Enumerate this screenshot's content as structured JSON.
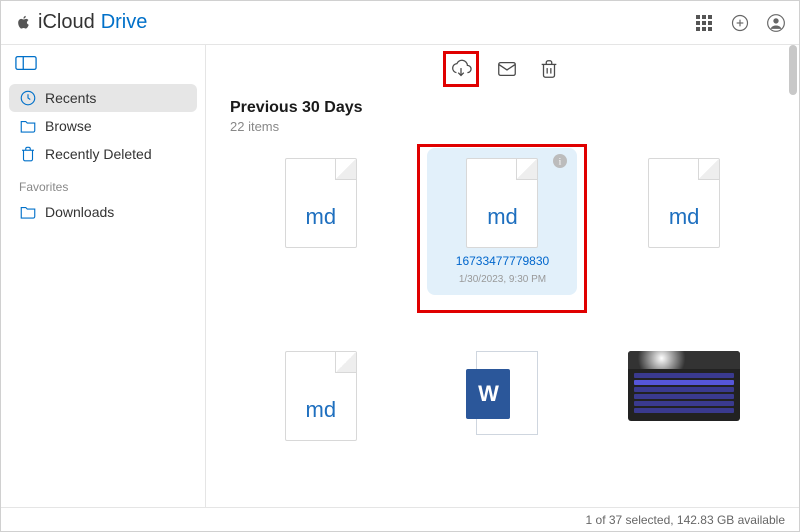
{
  "header": {
    "brand_part1": "iCloud",
    "brand_part2": "Drive"
  },
  "sidebar": {
    "items": [
      {
        "label": "Recents",
        "icon": "clock-icon",
        "active": true
      },
      {
        "label": "Browse",
        "icon": "folder-icon",
        "active": false
      },
      {
        "label": "Recently Deleted",
        "icon": "trash-icon",
        "active": false
      }
    ],
    "favorites_label": "Favorites",
    "favorites": [
      {
        "label": "Downloads",
        "icon": "folder-icon"
      }
    ]
  },
  "toolbar": {
    "download_label": "download",
    "mail_label": "mail",
    "delete_label": "delete"
  },
  "section": {
    "title": "Previous 30 Days",
    "count": "22 items"
  },
  "files": [
    {
      "kind": "md",
      "ext_label": "md",
      "selected": false
    },
    {
      "kind": "md",
      "ext_label": "md",
      "selected": true,
      "name": "16733477779830",
      "meta": "1/30/2023, 9:30 PM"
    },
    {
      "kind": "md",
      "ext_label": "md",
      "selected": false
    },
    {
      "kind": "md",
      "ext_label": "md",
      "selected": false
    },
    {
      "kind": "word",
      "ext_label": "W",
      "selected": false
    },
    {
      "kind": "image",
      "selected": false
    }
  ],
  "footer": {
    "status": "1 of 37 selected, 142.83 GB available"
  }
}
